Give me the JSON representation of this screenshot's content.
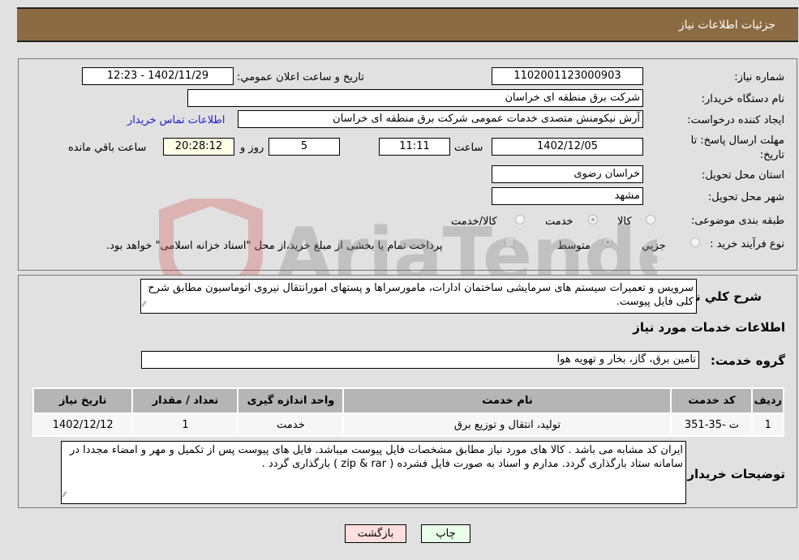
{
  "header": {
    "title": "جزئيات اطلاعات نياز"
  },
  "fields": {
    "need_number": {
      "label": "شماره نياز:",
      "value": "1102001123000903"
    },
    "announce_datetime": {
      "label": "تاريخ و ساعت اعلان عمومي:",
      "value": "1402/11/29 - 12:23"
    },
    "buyer_org": {
      "label": "نام دستگاه خريدار:",
      "value": "شرکت برق منطقه ای خراسان"
    },
    "creator": {
      "label": "ايجاد کننده درخواست:",
      "value": "آرش نیکومنش متصدی خدمات عمومی شرکت برق منطقه ای خراسان",
      "contact_link": "اطلاعات تماس خريدار"
    },
    "deadline": {
      "label_line1": "مهلت ارسال پاسخ: تا",
      "label_line2": "تاريخ:",
      "date": "1402/12/05",
      "time_label": "ساعت",
      "time": "11:11",
      "days": "5",
      "days_label": "روز و",
      "remaining": "20:28:12",
      "remaining_label": "ساعت باقي مانده"
    },
    "province": {
      "label": "استان محل تحويل:",
      "value": "خراسان رضوی"
    },
    "city": {
      "label": "شهر محل تحويل:",
      "value": "مشهد"
    },
    "category": {
      "label": "طبقه بندی موضوعی:",
      "options": [
        "کالا",
        "خدمت",
        "کالا/خدمت"
      ],
      "selected": "خدمت"
    },
    "purchase_type": {
      "label": "نوع فرآيند خريد :",
      "options": [
        "جزيي",
        "متوسط"
      ],
      "selected": "متوسط",
      "treasury_note": "پرداخت تمام يا بخشی از مبلغ خريد،از محل \"اسناد خزانه اسلامی\" خواهد بود."
    }
  },
  "description": {
    "label": "شرح کلي نياز:",
    "value": "سرویس و تعمیرات سیستم های سرمایشی ساختمان ادارات، مامورسراها و  پستهای امورانتقال نیروی اتوماسیون مطابق شرح کلی فایل پیوست."
  },
  "services_section": {
    "title": "اطلاعات خدمات مورد نياز",
    "group_label": "گروه خدمت:",
    "group_value": "تامین برق، گاز، بخار و تهویه هوا",
    "table": {
      "headers": [
        "رديف",
        "کد خدمت",
        "نام خدمت",
        "واحد اندازه گيری",
        "تعداد / مقدار",
        "تاريخ نياز"
      ],
      "rows": [
        [
          "1",
          "ت -35-351",
          "تولید، انتقال و توزیع برق",
          "خدمت",
          "1",
          "1402/12/12"
        ]
      ]
    }
  },
  "buyer_notes": {
    "label": "توضيحات خريدار:",
    "value": "ایران کد مشابه می باشد . کالا های مورد نیاز مطابق مشخصات فایل پیوست میباشد. فایل های پیوست پس از تکمیل و مهر و امضاء مجددا در سامانه ستاد بارگذاری گردد. مدارم و اسناد به صورت فایل فشرده ( zip & rar ) بارگذاری گردد ."
  },
  "buttons": {
    "print": "چاپ",
    "back": "بازگشت"
  },
  "watermark": {
    "text": "AriaTender.neT"
  },
  "colors": {
    "header_bg": "#8b6b42",
    "print_bg": "#eaffea",
    "back_bg": "#ffdede",
    "remaining_bg": "#ffffe6",
    "link": "#1b1bd6"
  }
}
